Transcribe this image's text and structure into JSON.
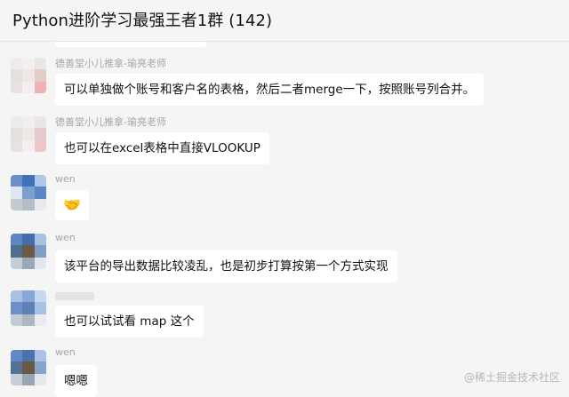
{
  "window": {
    "title": "Python进阶学习最强王者1群 (142)"
  },
  "messages": [
    {
      "sender": "德善堂小儿推拿-瑜亮老师",
      "text": "可以单独做个账号和客户名的表格，然后二者merge一下，按照账号列合并。"
    },
    {
      "sender": "德善堂小儿推拿-瑜亮老师",
      "text": "也可以在excel表格中直接VLOOKUP"
    },
    {
      "sender": "wen",
      "text": "🤝"
    },
    {
      "sender": "wen",
      "text": "该平台的导出数据比较凌乱，也是初步打算按第一个方式实现"
    },
    {
      "sender": "",
      "text": "也可以试试看 map 这个"
    },
    {
      "sender": "wen",
      "text": "嗯嗯"
    }
  ],
  "watermark": "@稀土掘金技术社区",
  "colors": {
    "background": "#f5f5f5",
    "bubble": "#ffffff",
    "sender_name": "#a5a5a5"
  },
  "icons": {
    "emoji_handshake": "handshake-emoji"
  }
}
